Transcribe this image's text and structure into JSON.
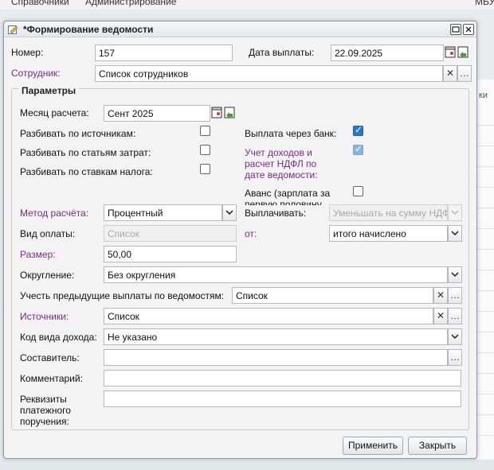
{
  "topbar": {
    "menu1": "Справочники",
    "menu2": "Администрирование",
    "right": "МБУ"
  },
  "bg_right": {
    "text": "ки"
  },
  "window": {
    "title": "*Формирование ведомости"
  },
  "header": {
    "number_label": "Номер:",
    "number_value": "157",
    "date_label": "Дата выплаты:",
    "date_value": "22.09.2025",
    "employee_label": "Сотрудник:",
    "employee_value": "Список сотрудников"
  },
  "params": {
    "legend": "Параметры",
    "month_label": "Месяц расчета:",
    "month_value": "Сент 2025",
    "split_sources_label": "Разбивать по источникам:",
    "split_costs_label": "Разбивать по статьям затрат:",
    "split_tax_label": "Разбивать по ставкам налога:",
    "bank_label": "Выплата через банк:",
    "ndfl_label_1": "Учет доходов и",
    "ndfl_label_2": "расчет НДФЛ по",
    "ndfl_label_3": "дате ведомости:",
    "advance_label_1": "Аванс (зарплата за",
    "advance_label_2": "первую половину",
    "method_label": "Метод расчёта:",
    "method_value": "Процентный",
    "pay_label": "Выплачивать:",
    "pay_value": "Уменьшать на сумму НДФ",
    "paytype_label": "Вид оплаты:",
    "paytype_value": "Список",
    "from_label": "от:",
    "from_value": "итого начислено",
    "size_label": "Размер:",
    "size_value": "50,00",
    "rounding_label": "Округление:",
    "rounding_value": "Без округления",
    "prev_label": "Учесть предыдущие выплаты по ведомостям:",
    "prev_value": "Список",
    "sources_label": "Источники:",
    "sources_value": "Список",
    "income_code_label": "Код вида дохода:",
    "income_code_value": "Не указано",
    "author_label": "Составитель:",
    "author_value": "",
    "comment_label": "Комментарий:",
    "comment_value": "",
    "req_label_1": "Реквизиты",
    "req_label_2": "платежного",
    "req_label_3": "поручения:",
    "req_value": ""
  },
  "buttons": {
    "apply": "Применить",
    "close": "Закрыть",
    "ellipsis": "…",
    "clear": "✕",
    "dropdown": "▾"
  },
  "checks": {
    "split_sources": false,
    "split_costs": false,
    "split_tax": false,
    "bank": true,
    "ndfl": true,
    "advance": false
  },
  "colors": {
    "required_label": "#7a2a8a",
    "checkbox_on": "#2d78c7"
  }
}
